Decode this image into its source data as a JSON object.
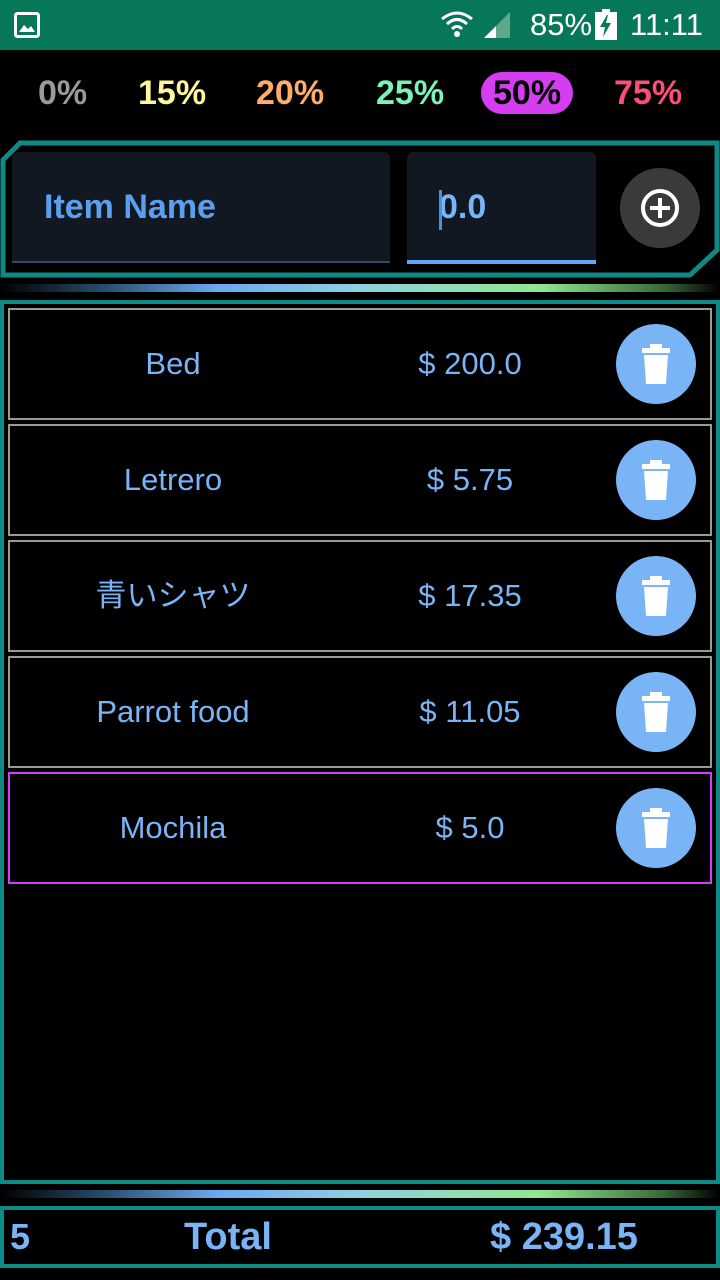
{
  "status_bar": {
    "battery_percent": "85%",
    "time": "11:11",
    "icons": [
      "gallery-icon",
      "wifi-icon",
      "signal-icon",
      "battery-charging-icon"
    ]
  },
  "tips": [
    {
      "label": "0%",
      "color": "#9a9a9a",
      "selected": false
    },
    {
      "label": "15%",
      "color": "#fff59a",
      "selected": false
    },
    {
      "label": "20%",
      "color": "#ffad6b",
      "selected": false
    },
    {
      "label": "25%",
      "color": "#7cf2b8",
      "selected": false
    },
    {
      "label": "50%",
      "color": "#000000",
      "selected": true
    },
    {
      "label": "75%",
      "color": "#ff4d7a",
      "selected": false
    }
  ],
  "input": {
    "name_placeholder": "Item Name",
    "price_value": "0.0",
    "add_icon": "plus-circle-icon"
  },
  "items": [
    {
      "name": "Bed",
      "price": "$ 200.0"
    },
    {
      "name": "Letrero",
      "price": "$ 5.75"
    },
    {
      "name": "青いシャツ",
      "price": "$ 17.35"
    },
    {
      "name": "Parrot food",
      "price": "$ 11.05"
    },
    {
      "name": "Mochila",
      "price": "$ 5.0"
    }
  ],
  "footer": {
    "count": "5",
    "total_label": "Total",
    "total_value": "$ 239.15"
  },
  "colors": {
    "accent_teal": "#0e8a86",
    "text_blue": "#79b4f6",
    "selected_magenta": "#d53df0",
    "status_bar": "#067758"
  }
}
